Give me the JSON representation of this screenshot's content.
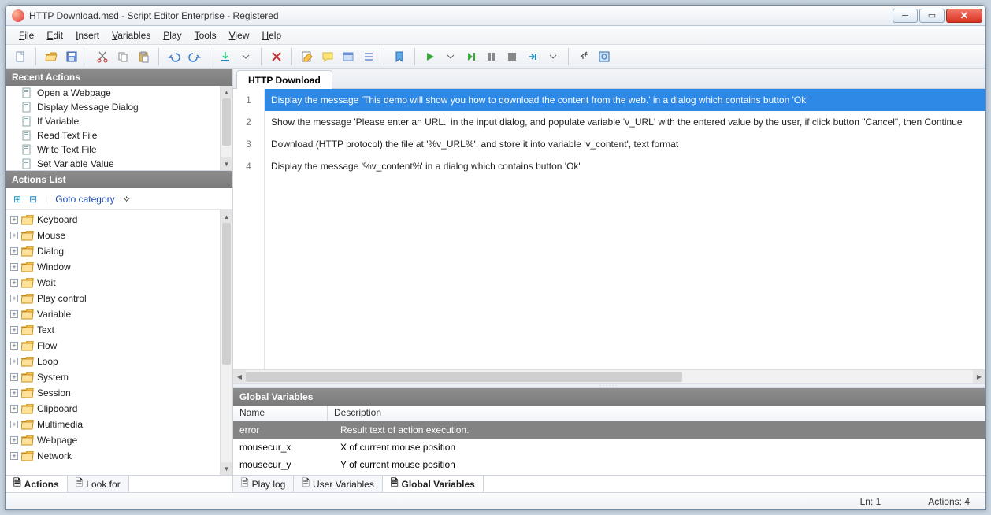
{
  "window": {
    "title": "HTTP Download.msd - Script Editor  Enterprise - Registered"
  },
  "menu": [
    "File",
    "Edit",
    "Insert",
    "Variables",
    "Play",
    "Tools",
    "View",
    "Help"
  ],
  "panels": {
    "recent_title": "Recent Actions",
    "recent": [
      "Open a Webpage",
      "Display Message Dialog",
      "If Variable",
      "Read Text File",
      "Write Text File",
      "Set Variable Value"
    ],
    "actions_title": "Actions List",
    "goto_label": "Goto category",
    "tree": [
      "Keyboard",
      "Mouse",
      "Dialog",
      "Window",
      "Wait",
      "Play control",
      "Variable",
      "Text",
      "Flow",
      "Loop",
      "System",
      "Session",
      "Clipboard",
      "Multimedia",
      "Webpage",
      "Network"
    ]
  },
  "left_tabs": {
    "actions": "Actions",
    "lookfor": "Look for"
  },
  "editor": {
    "tab": "HTTP Download",
    "lines": [
      "Display the message 'This demo will show you how to download the content from the web.' in a dialog which contains button 'Ok'",
      "Show the message 'Please enter an URL.' in the input dialog, and populate variable 'v_URL' with the entered value by the user, if click button \"Cancel\", then Continue",
      "Download (HTTP protocol) the file at '%v_URL%', and store it into variable 'v_content', text format",
      "Display the message '%v_content%' in a dialog which contains button 'Ok'"
    ],
    "selected": 0
  },
  "gv": {
    "title": "Global Variables",
    "col_name": "Name",
    "col_desc": "Description",
    "rows": [
      {
        "name": "error",
        "desc": "Result text of action execution."
      },
      {
        "name": "mousecur_x",
        "desc": "X of current mouse position"
      },
      {
        "name": "mousecur_y",
        "desc": "Y of current mouse position"
      }
    ],
    "selected": 0
  },
  "bottom_tabs": {
    "playlog": "Play log",
    "uservars": "User Variables",
    "globalvars": "Global Variables"
  },
  "status": {
    "ln": "Ln: 1",
    "actions": "Actions: 4"
  }
}
